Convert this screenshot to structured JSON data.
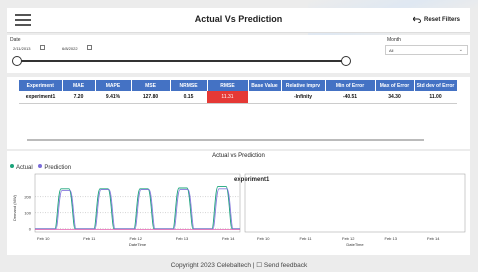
{
  "header": {
    "title": "Actual Vs Prediction",
    "reset_label": "Reset Filters"
  },
  "filters": {
    "date_label": "Date",
    "date_start": "2/11/2013",
    "date_end": "6/8/2022",
    "month_label": "Month",
    "month_value": "All"
  },
  "table": {
    "columns": [
      "Experiment",
      "MAE",
      "MAPE",
      "MSE",
      "NRMSE",
      "RMSE",
      "Base Value",
      "Relative imprv",
      "Min of Error",
      "Max of Error",
      "Std dev of Error"
    ],
    "rows": [
      [
        "experiment1",
        "7.20",
        "9.41%",
        "127.80",
        "0.15",
        "11.31",
        "",
        "-Infinity",
        "-40.51",
        "34.30",
        "11.00"
      ]
    ]
  },
  "chart": {
    "title": "Actual vs Prediction"
  },
  "footer": {
    "text": "Copyright 2023 Celebaltech | ☐ Send feedback"
  },
  "colors": {
    "actual": "#1aa37a",
    "prediction": "#7b6cd9",
    "header_blue": "#4472c4",
    "rmse_red": "#e53935"
  },
  "chart_data": {
    "type": "line",
    "title": "Actual vs Prediction",
    "legend": [
      "Actual",
      "Prediction"
    ],
    "legend_placement": "top-left",
    "panels": [
      {
        "subtitle": "experiment1",
        "xlabel": "DateTime",
        "ylabel": "Demand (MW)",
        "x_ticks": [
          "Feb 10",
          "Feb 11",
          "Feb 12",
          "Feb 13",
          "Feb 14"
        ],
        "y_ticks": [
          0,
          100,
          200
        ],
        "ylim": [
          -20,
          280
        ],
        "series": [
          {
            "name": "Actual",
            "peak_values": [
              250,
              250,
              250,
              255,
              265
            ]
          },
          {
            "name": "Prediction",
            "peak_values": [
              240,
              245,
              245,
              245,
              250
            ]
          }
        ]
      },
      {
        "subtitle": "",
        "xlabel": "DateTime",
        "x_ticks": [
          "Feb 10",
          "Feb 11",
          "Feb 12",
          "Feb 13",
          "Feb 14"
        ],
        "series": []
      }
    ]
  }
}
